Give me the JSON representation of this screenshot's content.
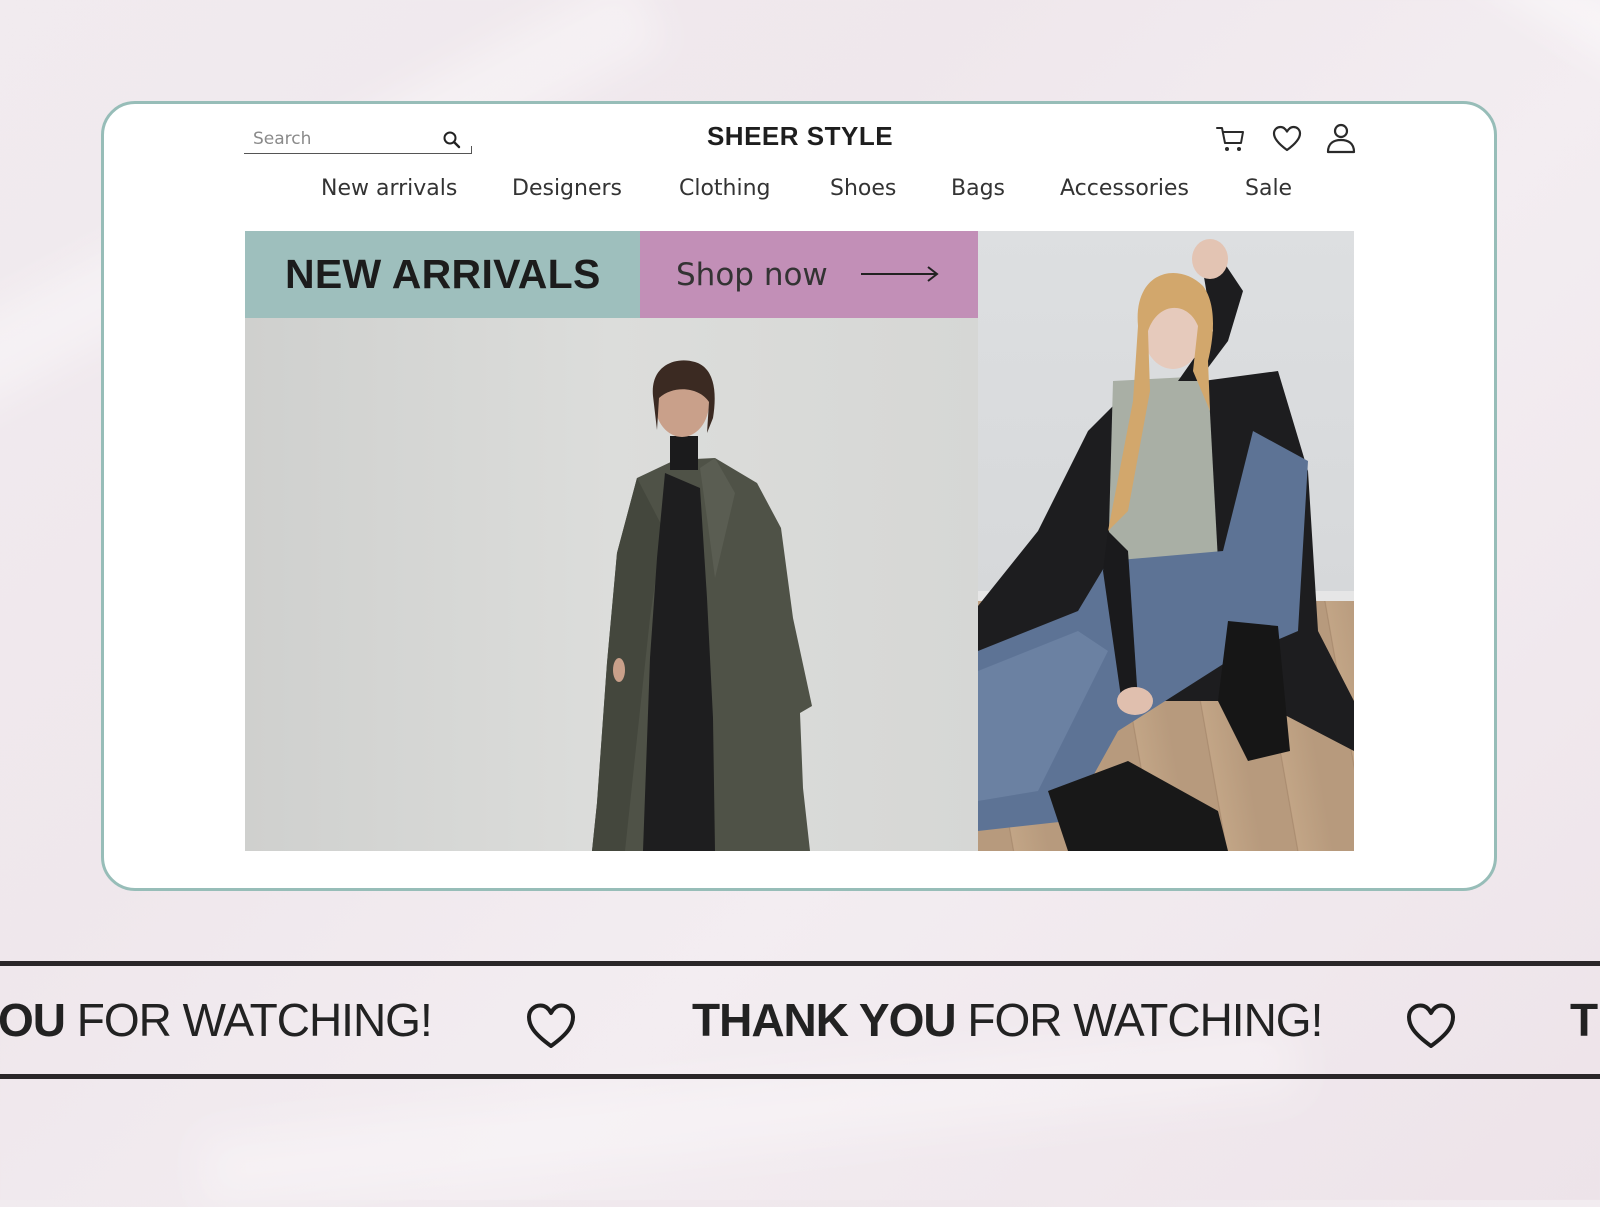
{
  "header": {
    "search_placeholder": "Search",
    "brand": "SHEER STYLE",
    "icons": [
      "search-icon",
      "cart-icon",
      "heart-icon",
      "user-icon"
    ]
  },
  "nav": {
    "items": [
      "New arrivals",
      "Designers",
      "Clothing",
      "Shoes",
      "Bags",
      "Accessories",
      "Sale"
    ]
  },
  "hero": {
    "title": "NEW ARRIVALS",
    "cta_label": "Shop now",
    "cta_icon": "arrow-right-icon"
  },
  "ticker": {
    "bold_part": "THANK YOU",
    "light_part": "FOR WATCHING!",
    "partial_left_bold": "OU",
    "partial_right_bold": "T",
    "icon": "heart-icon"
  },
  "colors": {
    "card_border": "#97bdb8",
    "new_arrivals_tile": "#9ebfbd",
    "shop_now_tile": "#c28fb7",
    "ticker_border": "#2a2628"
  }
}
